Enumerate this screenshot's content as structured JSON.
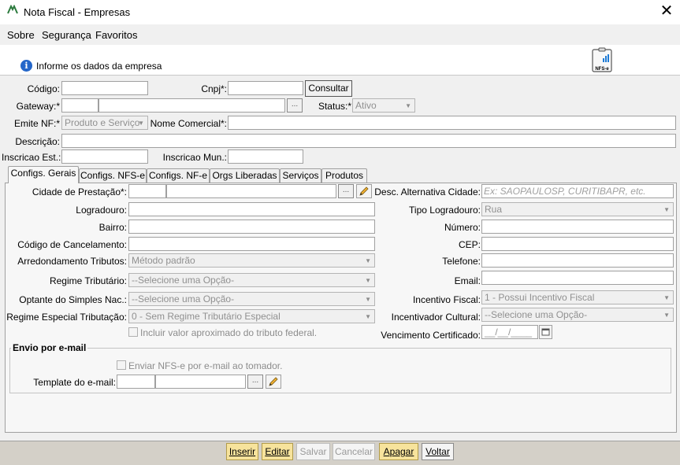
{
  "window": {
    "title": "Nota Fiscal - Empresas",
    "close_glyph": "✕"
  },
  "menu": [
    "Sobre",
    "Segurança",
    "Favoritos"
  ],
  "header": {
    "info": "Informe os dados da empresa",
    "icon_label": "NFS-e"
  },
  "form": {
    "codigo_label": "Código:",
    "cnpj_label": "Cnpj*:",
    "consultar_button": "Consultar",
    "gateway_label": "Gateway:*",
    "browse_button": "...",
    "status_label": "Status:*",
    "status_value": "Ativo",
    "emite_nf_label": "Emite NF:*",
    "emite_nf_value": "Produto e Serviço",
    "nome_comercial_label": "Nome Comercial*:",
    "descricao_label": "Descrição:",
    "inscricao_est_label": "Inscricao Est.:",
    "inscricao_mun_label": "Inscricao Mun.:"
  },
  "tabs": [
    "Configs. Gerais",
    "Configs. NFS-e",
    "Configs. NF-e",
    "Orgs Liberadas",
    "Serviços",
    "Produtos"
  ],
  "gerais": {
    "cidade_label": "Cidade de Prestação*:",
    "logradouro_label": "Logradouro:",
    "bairro_label": "Bairro:",
    "cod_cancelamento_label": "Código de Cancelamento:",
    "arredondamento_label": "Arredondamento Tributos:",
    "arredondamento_value": "Método padrão",
    "regime_label": "Regime Tributário:",
    "regime_value": "--Selecione uma Opção-",
    "optante_label": "Optante do Simples Nac.:",
    "optante_value": "--Selecione uma Opção-",
    "regime_especial_label": "Regime Especial Tributação:",
    "regime_especial_value": "0 - Sem Regime Tributário Especial",
    "incluir_label": "Incluir valor aproximado do tributo federal.",
    "desc_alt_label": "Desc. Alternativa Cidade:",
    "desc_alt_placeholder": "Ex: SAOPAULOSP, CURITIBAPR, etc.",
    "tipo_logradouro_label": "Tipo Logradouro:",
    "tipo_logradouro_value": "Rua",
    "numero_label": "Número:",
    "cep_label": "CEP:",
    "telefone_label": "Telefone:",
    "email_label": "Email:",
    "incentivo_fiscal_label": "Incentivo Fiscal:",
    "incentivo_fiscal_value": "1 - Possui Incentivo Fiscal",
    "incentivador_label": "Incentivador Cultural:",
    "incentivador_value": "--Selecione uma Opção-",
    "vencimento_label": "Vencimento Certificado:",
    "vencimento_value": "__/__/____"
  },
  "envio": {
    "legend": "Envio por e-mail",
    "enviar_label": "Enviar NFS-e por e-mail ao tomador.",
    "template_label": "Template do e-mail:"
  },
  "actions": {
    "inserir": "Inserir",
    "editar": "Editar",
    "salvar": "Salvar",
    "cancelar": "Cancelar",
    "apagar": "Apagar",
    "voltar": "Voltar"
  },
  "colors": {
    "highlight_button": "#f7e39c",
    "info_blue": "#2466c9"
  }
}
